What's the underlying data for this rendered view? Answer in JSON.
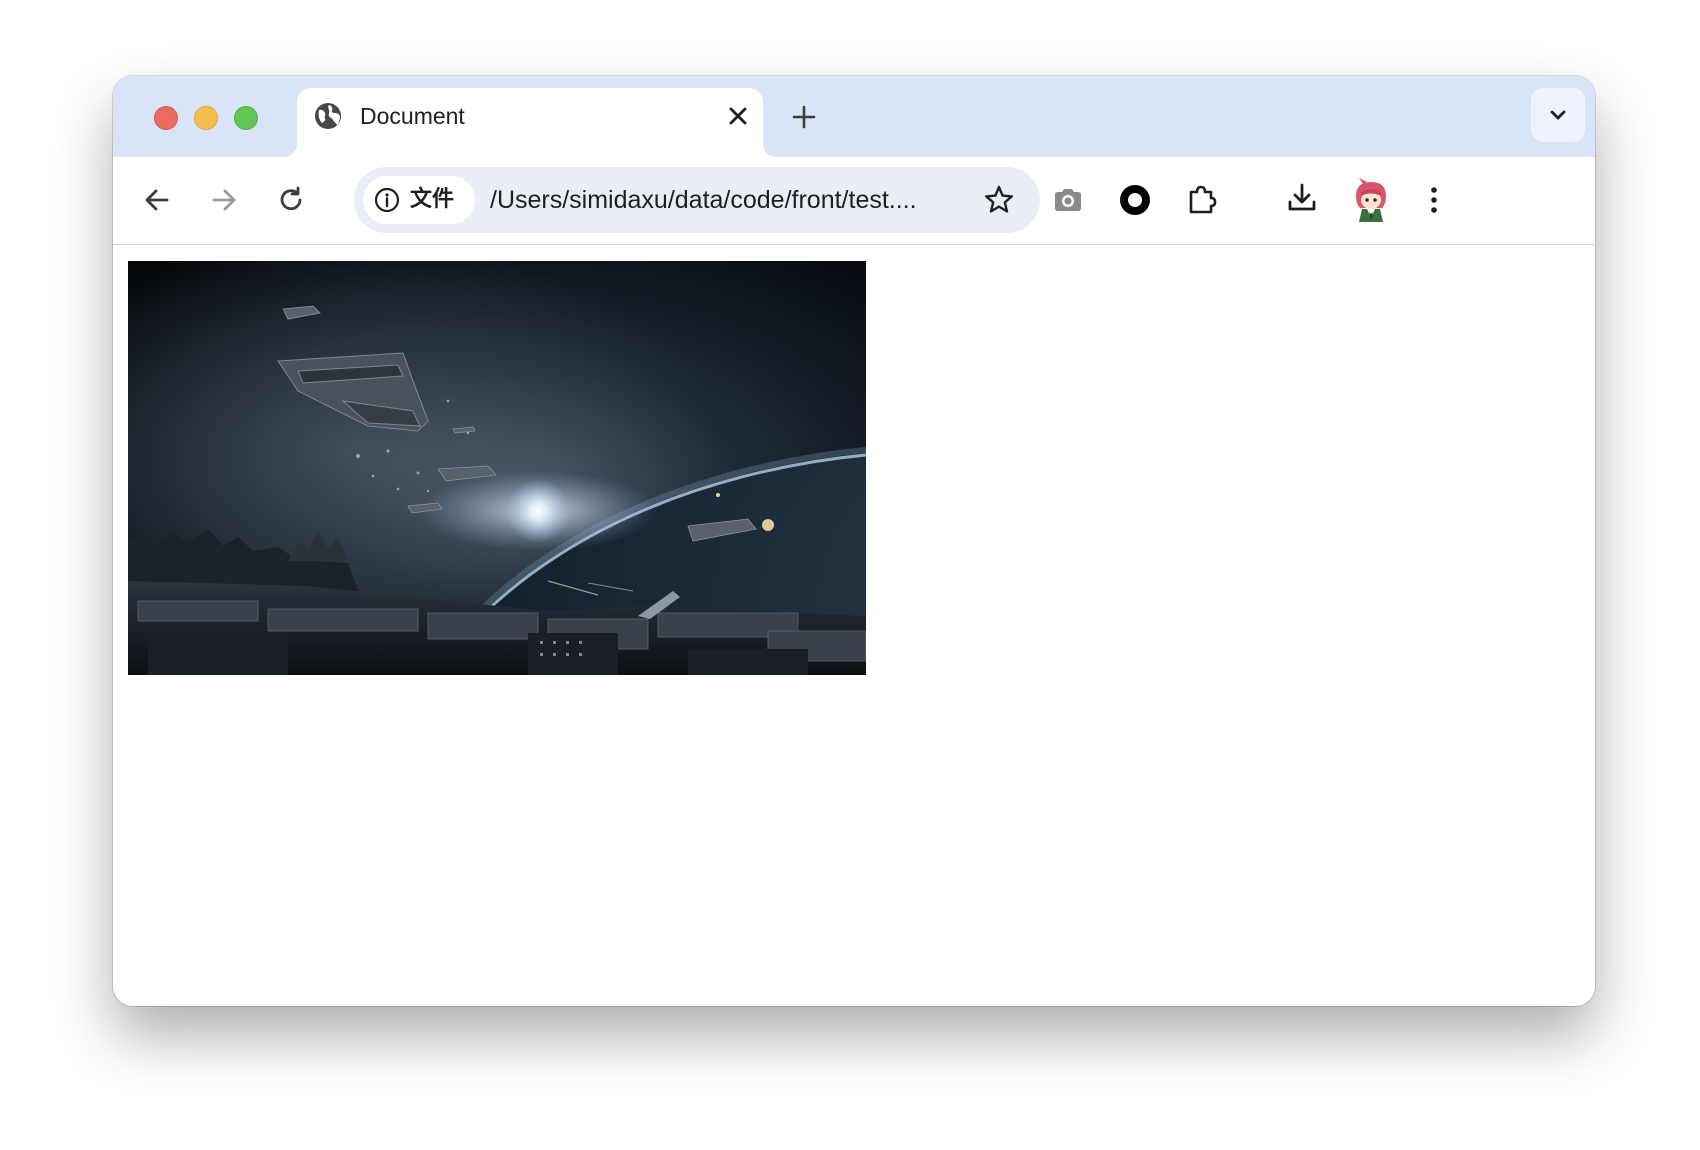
{
  "window": {
    "traffic_lights": [
      "close",
      "minimize",
      "maximize"
    ]
  },
  "tab": {
    "title": "Document",
    "favicon": "globe-icon",
    "close_icon": "close-icon"
  },
  "tabstrip": {
    "new_tab_icon": "plus-icon",
    "tab_search_icon": "chevron-down-icon"
  },
  "toolbar": {
    "back_icon": "back-arrow-icon",
    "forward_icon": "forward-arrow-icon",
    "reload_icon": "reload-icon",
    "site_info_icon": "info-icon",
    "site_info_label": "文件",
    "url": "/Users/simidaxu/data/code/front/test....",
    "bookmark_icon": "star-icon",
    "extensions": [
      "camera-icon",
      "record-circle-icon",
      "puzzle-icon"
    ],
    "download_icon": "download-icon",
    "profile_icon": "avatar-icon",
    "menu_icon": "kebab-menu-icon"
  },
  "content": {
    "image": "space-scene-image"
  },
  "colors": {
    "tabstrip_bg": "#d9e4f9",
    "omnibox_bg": "#e9eef6",
    "close": "#ed6a5e",
    "minimize": "#f5bf4f",
    "maximize": "#62c554"
  }
}
